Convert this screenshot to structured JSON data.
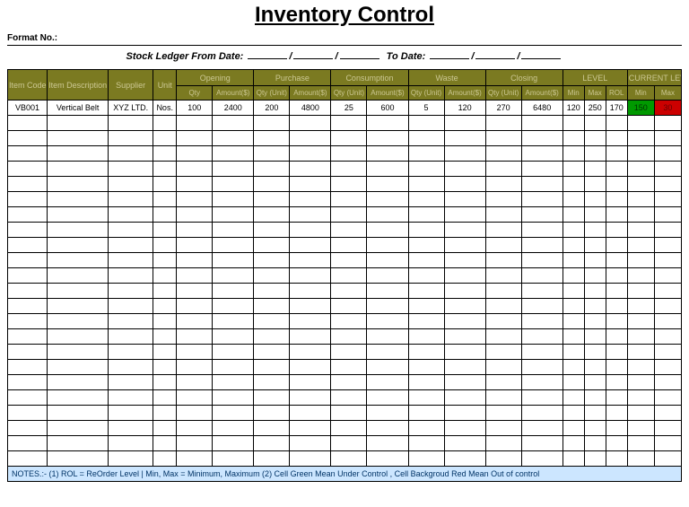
{
  "title": "Inventory Control",
  "format_label": "Format No.:",
  "date_line": {
    "prefix": "Stock Ledger From Date:",
    "to_label": "To Date:"
  },
  "headers": {
    "item_code": "Item Code",
    "item_desc": "Item Description",
    "supplier": "Supplier",
    "unit": "Unit",
    "opening": "Opening",
    "purchase": "Purchase",
    "consumption": "Consumption",
    "waste": "Waste",
    "closing": "Closing",
    "level": "LEVEL",
    "current_level": "CURRENT LEVEL",
    "qty": "Qty",
    "qty_unit": "Qty (Unit)",
    "amount": "Amount($)",
    "min": "Min",
    "max": "Max",
    "rol": "ROL"
  },
  "rows": [
    {
      "item_code": "VB001",
      "item_desc": "Vertical Belt",
      "supplier": "XYZ LTD.",
      "unit": "Nos.",
      "opening_qty": "100",
      "opening_amt": "2400",
      "purchase_qty": "200",
      "purchase_amt": "4800",
      "consumption_qty": "25",
      "consumption_amt": "600",
      "waste_qty": "5",
      "waste_amt": "120",
      "closing_qty": "270",
      "closing_amt": "6480",
      "level_min": "120",
      "level_max": "250",
      "level_rol": "170",
      "current_min": "150",
      "current_max": "30"
    }
  ],
  "notes": "NOTES.:- (1) ROL = ReOrder Level | Min, Max = Minimum, Maximum      (2) Cell Green Mean Under Control , Cell Backgroud Red Mean Out of control",
  "blank_rows_count": 23
}
